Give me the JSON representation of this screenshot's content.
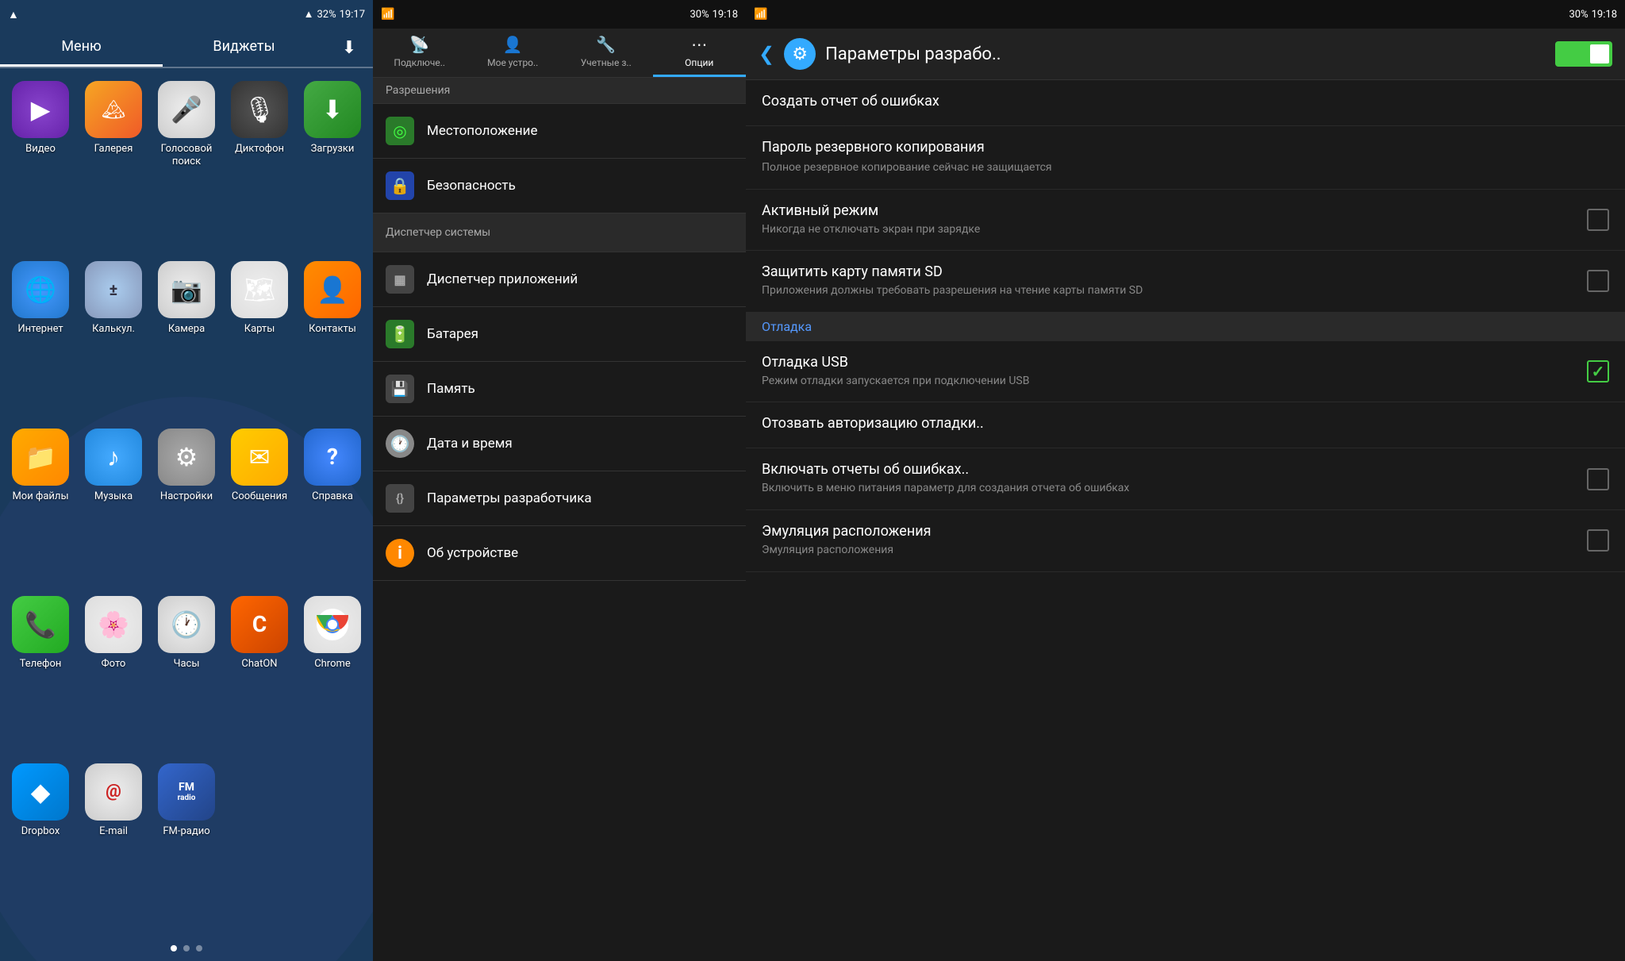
{
  "home": {
    "status_bar": {
      "wifi": "WiFi",
      "signal": "3G",
      "battery": "32%",
      "time": "19:17"
    },
    "tabs": [
      {
        "id": "menu",
        "label": "Меню",
        "active": true
      },
      {
        "id": "widgets",
        "label": "Виджеты",
        "active": false
      }
    ],
    "download_icon": "⬇",
    "apps": [
      {
        "id": "video",
        "label": "Видео",
        "icon": "▶",
        "class": "ic-video"
      },
      {
        "id": "gallery",
        "label": "Галерея",
        "icon": "🖼",
        "class": "ic-gallery"
      },
      {
        "id": "voice",
        "label": "Голосовой поиск",
        "icon": "🎤",
        "class": "ic-voice"
      },
      {
        "id": "recorder",
        "label": "Диктофон",
        "icon": "🎙",
        "class": "ic-recorder"
      },
      {
        "id": "downloads",
        "label": "Загрузки",
        "icon": "⬇",
        "class": "ic-download"
      },
      {
        "id": "internet",
        "label": "Интернет",
        "icon": "🌐",
        "class": "ic-internet"
      },
      {
        "id": "calc",
        "label": "Калькул.",
        "icon": "±",
        "class": "ic-calc"
      },
      {
        "id": "camera",
        "label": "Камера",
        "icon": "📷",
        "class": "ic-camera"
      },
      {
        "id": "maps",
        "label": "Карты",
        "icon": "🗺",
        "class": "ic-maps"
      },
      {
        "id": "contacts",
        "label": "Контакты",
        "icon": "👤",
        "class": "ic-contacts"
      },
      {
        "id": "myfiles",
        "label": "Мои файлы",
        "icon": "📁",
        "class": "ic-myfiles"
      },
      {
        "id": "music",
        "label": "Музыка",
        "icon": "♪",
        "class": "ic-music"
      },
      {
        "id": "settings",
        "label": "Настройки",
        "icon": "⚙",
        "class": "ic-settings"
      },
      {
        "id": "messages",
        "label": "Сообщения",
        "icon": "✉",
        "class": "ic-messages"
      },
      {
        "id": "help",
        "label": "Справка",
        "icon": "?",
        "class": "ic-help"
      },
      {
        "id": "phone",
        "label": "Телефон",
        "icon": "📞",
        "class": "ic-phone"
      },
      {
        "id": "photos",
        "label": "Фото",
        "icon": "🌸",
        "class": "ic-photos"
      },
      {
        "id": "clock",
        "label": "Часы",
        "icon": "🕐",
        "class": "ic-clock"
      },
      {
        "id": "chaton",
        "label": "ChatON",
        "icon": "C",
        "class": "ic-chaton"
      },
      {
        "id": "chrome",
        "label": "Chrome",
        "icon": "●",
        "class": "ic-chrome"
      },
      {
        "id": "dropbox",
        "label": "Dropbox",
        "icon": "◆",
        "class": "ic-dropbox"
      },
      {
        "id": "email",
        "label": "E-mail",
        "icon": "@",
        "class": "ic-email"
      },
      {
        "id": "fmradio",
        "label": "FM-радио",
        "icon": "📻",
        "class": "ic-fmradio"
      }
    ],
    "dots": [
      true,
      false,
      false
    ]
  },
  "settings": {
    "status_bar": {
      "wifi": "WiFi",
      "signal": "3G",
      "battery": "30%",
      "time": "19:18"
    },
    "tabs": [
      {
        "id": "connect",
        "label": "Подключе..",
        "icon": "📡",
        "active": false
      },
      {
        "id": "mydevice",
        "label": "Мое устро..",
        "icon": "👤",
        "active": false
      },
      {
        "id": "accounts",
        "label": "Учетные з..",
        "icon": "🔧",
        "active": false
      },
      {
        "id": "options",
        "label": "Опции",
        "icon": "⋯",
        "active": true
      }
    ],
    "section_permissions": "Разрешения",
    "items": [
      {
        "id": "location",
        "label": "Местоположение",
        "icon": "◎",
        "iconClass": "si-location",
        "highlighted": false
      },
      {
        "id": "security",
        "label": "Безопасность",
        "icon": "🔒",
        "iconClass": "si-security",
        "highlighted": false
      },
      {
        "id": "sysmanager",
        "label": "Диспетчер системы",
        "icon": "",
        "iconClass": "",
        "highlighted": true,
        "isSection": true
      },
      {
        "id": "appmanager",
        "label": "Диспетчер приложений",
        "icon": "▦",
        "iconClass": "si-appmanager",
        "highlighted": false
      },
      {
        "id": "battery",
        "label": "Батарея",
        "icon": "🔋",
        "iconClass": "si-battery",
        "highlighted": false
      },
      {
        "id": "memory",
        "label": "Память",
        "icon": "💾",
        "iconClass": "si-memory",
        "highlighted": false
      },
      {
        "id": "datetime",
        "label": "Дата и время",
        "icon": "🕐",
        "iconClass": "si-datetime",
        "highlighted": false
      },
      {
        "id": "devtools",
        "label": "Параметры разработчика",
        "icon": "{}",
        "iconClass": "si-devtools",
        "highlighted": false
      },
      {
        "id": "about",
        "label": "Об устройстве",
        "icon": "i",
        "iconClass": "si-about",
        "highlighted": false
      }
    ]
  },
  "developer": {
    "status_bar": {
      "wifi": "WiFi",
      "signal": "3G",
      "battery": "30%",
      "time": "19:18"
    },
    "header": {
      "back_icon": "❮",
      "gear_icon": "⚙",
      "title": "Параметры разрабо..",
      "toggle_on": true
    },
    "items": [
      {
        "id": "bug-report",
        "title": "Создать отчет об ошибках",
        "subtitle": "",
        "hasCheckbox": false,
        "checked": false,
        "isSection": false
      },
      {
        "id": "backup-password",
        "title": "Пароль резервного копирования",
        "subtitle": "Полное резервное копирование сейчас не защищается",
        "hasCheckbox": false,
        "checked": false,
        "isSection": false
      },
      {
        "id": "stay-awake",
        "title": "Активный режим",
        "subtitle": "Никогда не отключать экран при зарядке",
        "hasCheckbox": true,
        "checked": false,
        "isSection": false
      },
      {
        "id": "protect-sd",
        "title": "Защитить карту памяти SD",
        "subtitle": "Приложения должны требовать разрешения на чтение карты памяти SD",
        "hasCheckbox": true,
        "checked": false,
        "isSection": false
      },
      {
        "id": "debug-section",
        "title": "Отладка",
        "subtitle": "",
        "hasCheckbox": false,
        "checked": false,
        "isSection": true
      },
      {
        "id": "usb-debug",
        "title": "Отладка USB",
        "subtitle": "Режим отладки запускается при подключении USB",
        "hasCheckbox": true,
        "checked": true,
        "isSection": false
      },
      {
        "id": "revoke-auth",
        "title": "Отозвать авторизацию отладки..",
        "subtitle": "",
        "hasCheckbox": false,
        "checked": false,
        "isSection": false
      },
      {
        "id": "error-reports",
        "title": "Включать отчеты об ошибках..",
        "subtitle": "Включить в меню питания параметр для создания отчета об ошибках",
        "hasCheckbox": true,
        "checked": false,
        "isSection": false
      },
      {
        "id": "mock-location",
        "title": "Эмуляция расположения",
        "subtitle": "Эмуляция расположения",
        "hasCheckbox": true,
        "checked": false,
        "isSection": false
      }
    ]
  }
}
